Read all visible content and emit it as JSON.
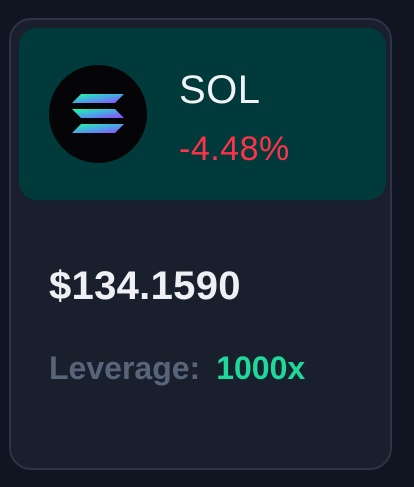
{
  "asset": {
    "symbol": "SOL",
    "change_pct": "-4.48%",
    "price": "$134.1590",
    "leverage_label": "Leverage:",
    "leverage_value": "1000x",
    "logo_icon": "solana-logo-icon"
  },
  "colors": {
    "page_bg": "#111522",
    "card_bg": "#1a1f2e",
    "card_border": "#2c3447",
    "header_bg": "#003a3a",
    "negative": "#ff3348",
    "positive": "#1fd99b",
    "muted": "#586478",
    "text": "#f1f3f6"
  }
}
